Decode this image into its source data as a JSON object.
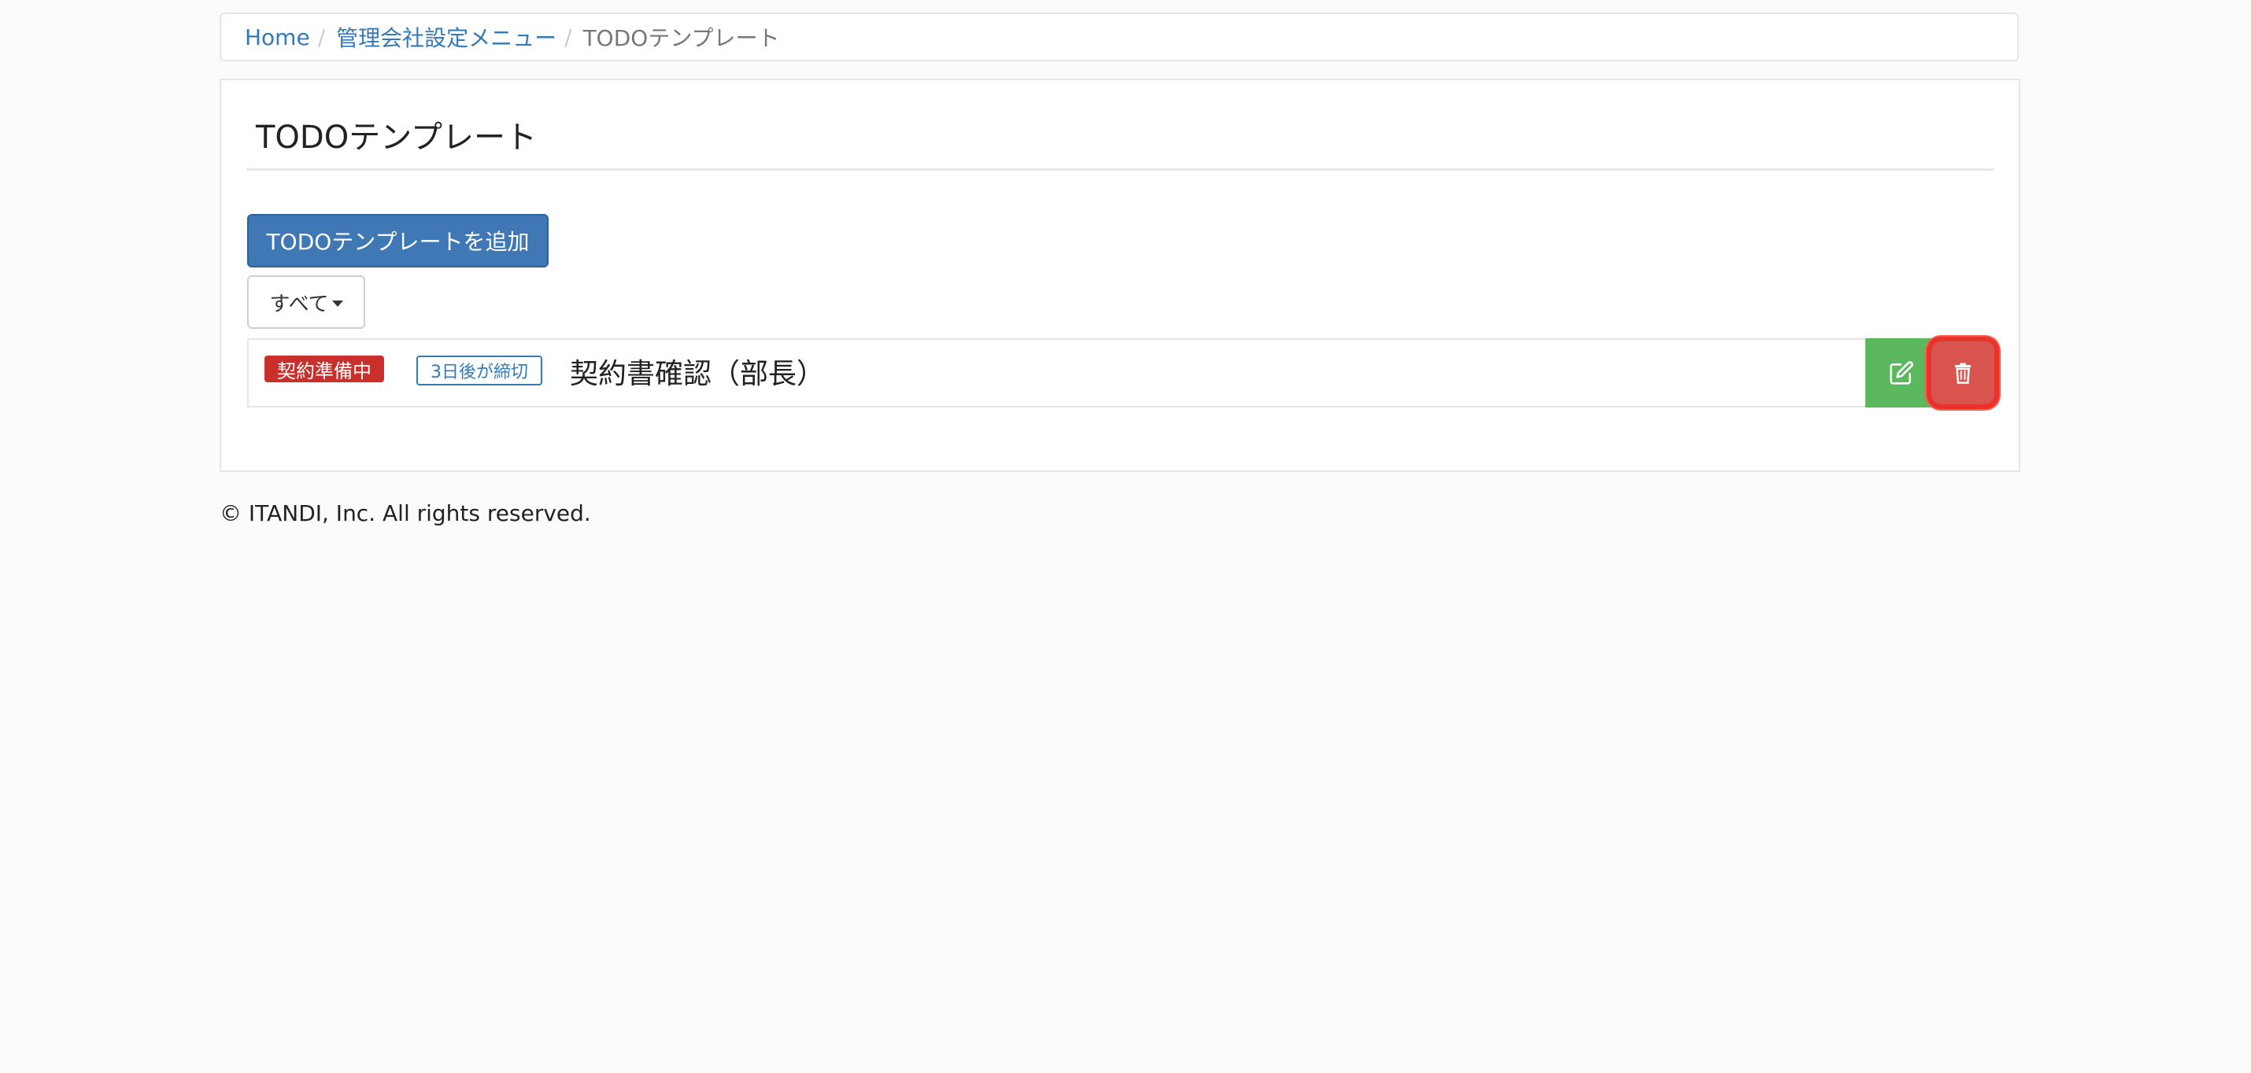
{
  "breadcrumb": {
    "home": "Home",
    "menu": "管理会社設定メニュー",
    "current": "TODOテンプレート",
    "separator": "/"
  },
  "page": {
    "title": "TODOテンプレート",
    "add_button": "TODOテンプレートを追加",
    "filter_label": "すべて"
  },
  "todos": [
    {
      "status": "契約準備中",
      "deadline": "3日後が締切",
      "title": "契約書確認（部長）",
      "edit_icon": "edit-icon",
      "delete_icon": "trash-icon"
    }
  ],
  "footer": {
    "copyright": "© ITANDI, Inc. All rights reserved."
  },
  "colors": {
    "primary": "#3f78b4",
    "success": "#5cb85c",
    "danger": "#d9534f",
    "status_badge": "#c9302c",
    "link": "#337ab7"
  }
}
